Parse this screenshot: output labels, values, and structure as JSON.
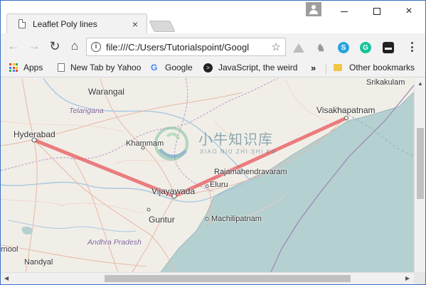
{
  "window": {
    "tab_title": "Leaflet Poly lines",
    "tab_close_icon": "×",
    "minimize_icon": "minimize-icon",
    "maximize_icon": "maximize-icon",
    "close_icon": "×"
  },
  "toolbar": {
    "back_icon": "←",
    "forward_icon": "→",
    "reload_icon": "↻",
    "home_icon": "⌂",
    "info_icon": "i",
    "url": "file:///C:/Users/Tutorialspoint/Googl",
    "star_icon": "☆",
    "skype_letter": "S",
    "grammarly_letter": "G"
  },
  "bookmarks": {
    "apps": "Apps",
    "items": [
      "New Tab by Yahoo",
      "Google",
      "JavaScript, the weird"
    ],
    "more": "»",
    "other": "Other bookmarks",
    "google_letter": "G"
  },
  "map": {
    "cities": {
      "warangal": "Warangal",
      "telangana": "Telangana",
      "hyderabad": "Hyderabad",
      "khammam": "Khammam",
      "vijayawada": "Vijayawada",
      "guntur": "Guntur",
      "machilipatnam": "Machilipatnam",
      "andhra_pradesh": "Andhra Pradesh",
      "nandyal": "Nandyal",
      "kurnool": "rnool",
      "eluru": "Eluru",
      "rajamahendravaram": "Rajamahendravaram",
      "visakhapatnam": "Visakhapatnam",
      "srikakulam": "Srikakulam"
    },
    "polyline_color": "#e8555a",
    "sea_color": "#b5d0d0",
    "land_color": "#f1eee8"
  },
  "watermark": {
    "text": "小牛知识库",
    "sub": "XIAO NIU ZHI SHI KU"
  },
  "scrollbars": {
    "up_arrow": "▲",
    "left_arrow": "◀",
    "right_arrow": "▶"
  }
}
